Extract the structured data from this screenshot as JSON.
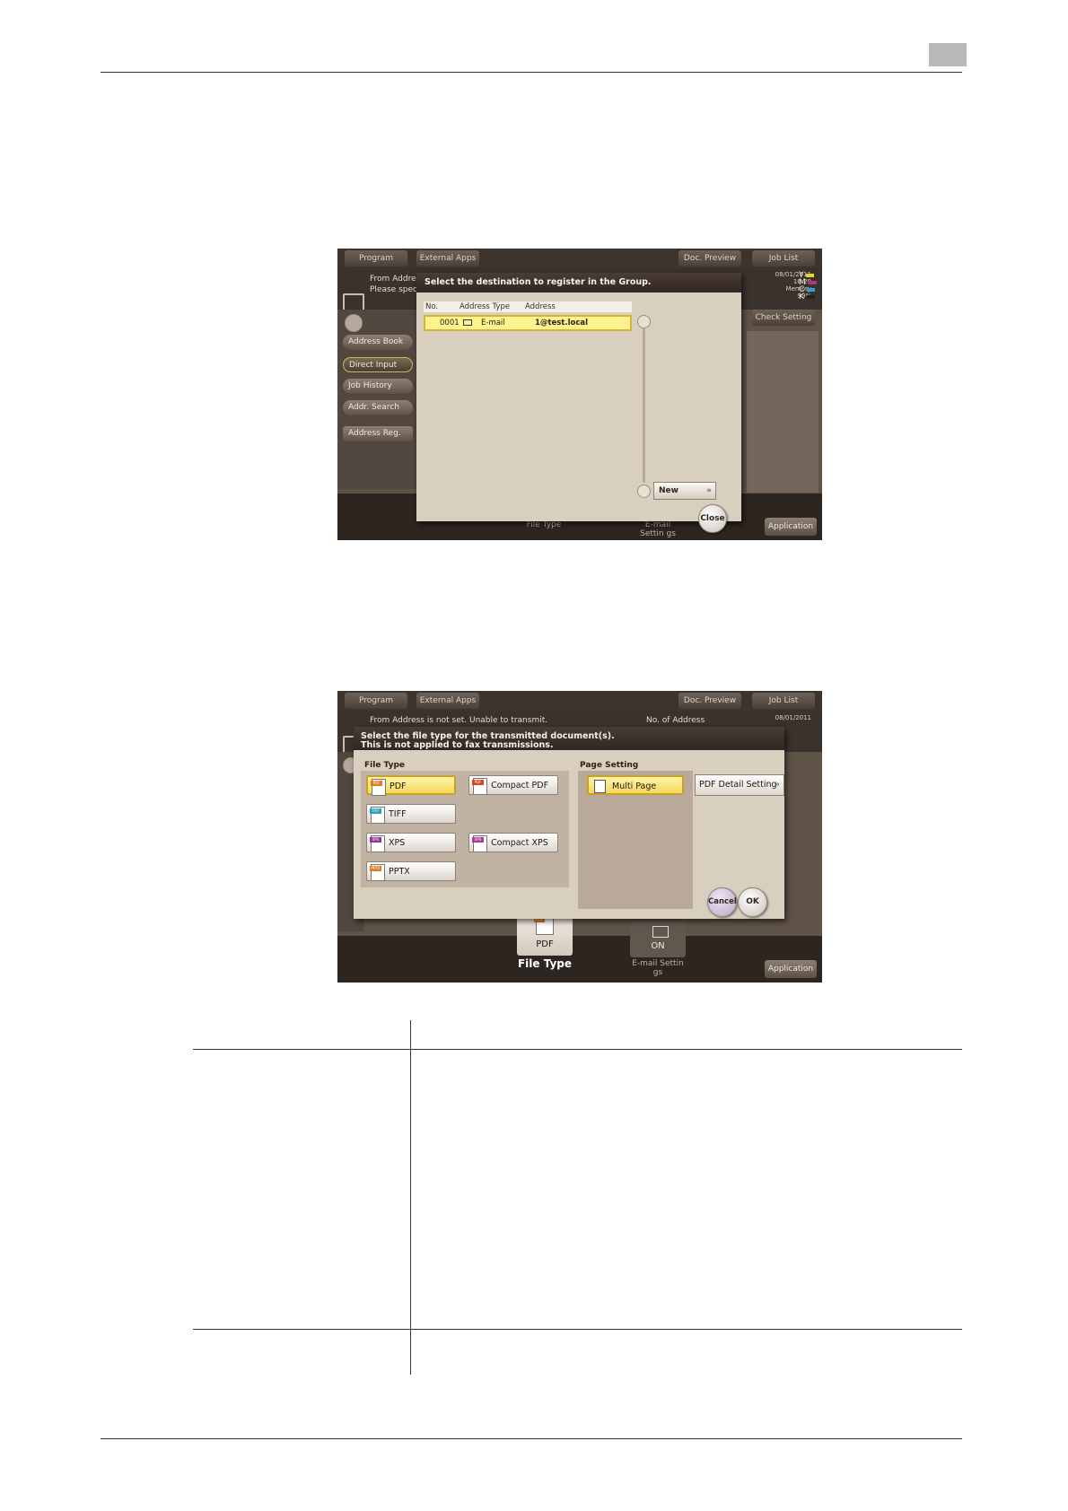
{
  "screen1": {
    "topbar": [
      "Program",
      "External Apps",
      "Doc. Preview",
      "Job List"
    ],
    "info_line1": "From Addres",
    "info_line2": "Please spec",
    "status_date": "08/01/2011",
    "status_time": "16:29",
    "status_memory_label": "Memory",
    "status_memory": "99%",
    "toner_letters": [
      "Y",
      "M",
      "C",
      "K"
    ],
    "left_buttons": [
      "Address Book",
      "Direct Input",
      "Job History",
      "Addr. Search",
      "Address Reg."
    ],
    "check_setting": "Check Setting",
    "dialog": {
      "title": "Select the destination to register in the Group.",
      "columns": {
        "no": "No.",
        "type": "Address Type",
        "address": "Address"
      },
      "row": {
        "no": "0001",
        "type": "E-mail",
        "address": "1@test.local"
      },
      "new_button": "New",
      "close_button": "Close"
    },
    "bottom": {
      "file_type": "File Type",
      "email_settings": "E-mail Settin gs",
      "application": "Application"
    }
  },
  "screen2": {
    "topbar": [
      "Program",
      "External Apps",
      "Doc. Preview",
      "Job List"
    ],
    "info_line1": "From Address is not set. Unable to transmit.",
    "info_right": "No. of Address",
    "status_date": "08/01/2011",
    "dialog": {
      "title_line1": "Select the file type for the transmitted document(s).",
      "title_line2": "This is not applied to fax transmissions.",
      "file_type_label": "File Type",
      "page_setting_label": "Page Setting",
      "file_types": [
        "PDF",
        "Compact PDF",
        "TIFF",
        "XPS",
        "Compact XPS",
        "PPTX"
      ],
      "icon_tags": [
        "PDF",
        "PDF",
        "TIFF",
        "XPS",
        "XPS",
        "PPTX"
      ],
      "page_setting": "Multi Page",
      "pdf_detail": "PDF Detail Setting",
      "cancel": "Cancel",
      "ok": "OK"
    },
    "bottom": {
      "tab_pdf_icon": "PDF",
      "tab_pdf_value": "PDF",
      "tab_pdf_label": "File Type",
      "tab_email_value": "ON",
      "tab_email_label": "E-mail Settin gs",
      "application": "Application"
    }
  },
  "colors": {
    "dialog_bg": "#d8cfbf",
    "selected_yellow": "#fff38f",
    "frame_brown": "#5f5348"
  }
}
